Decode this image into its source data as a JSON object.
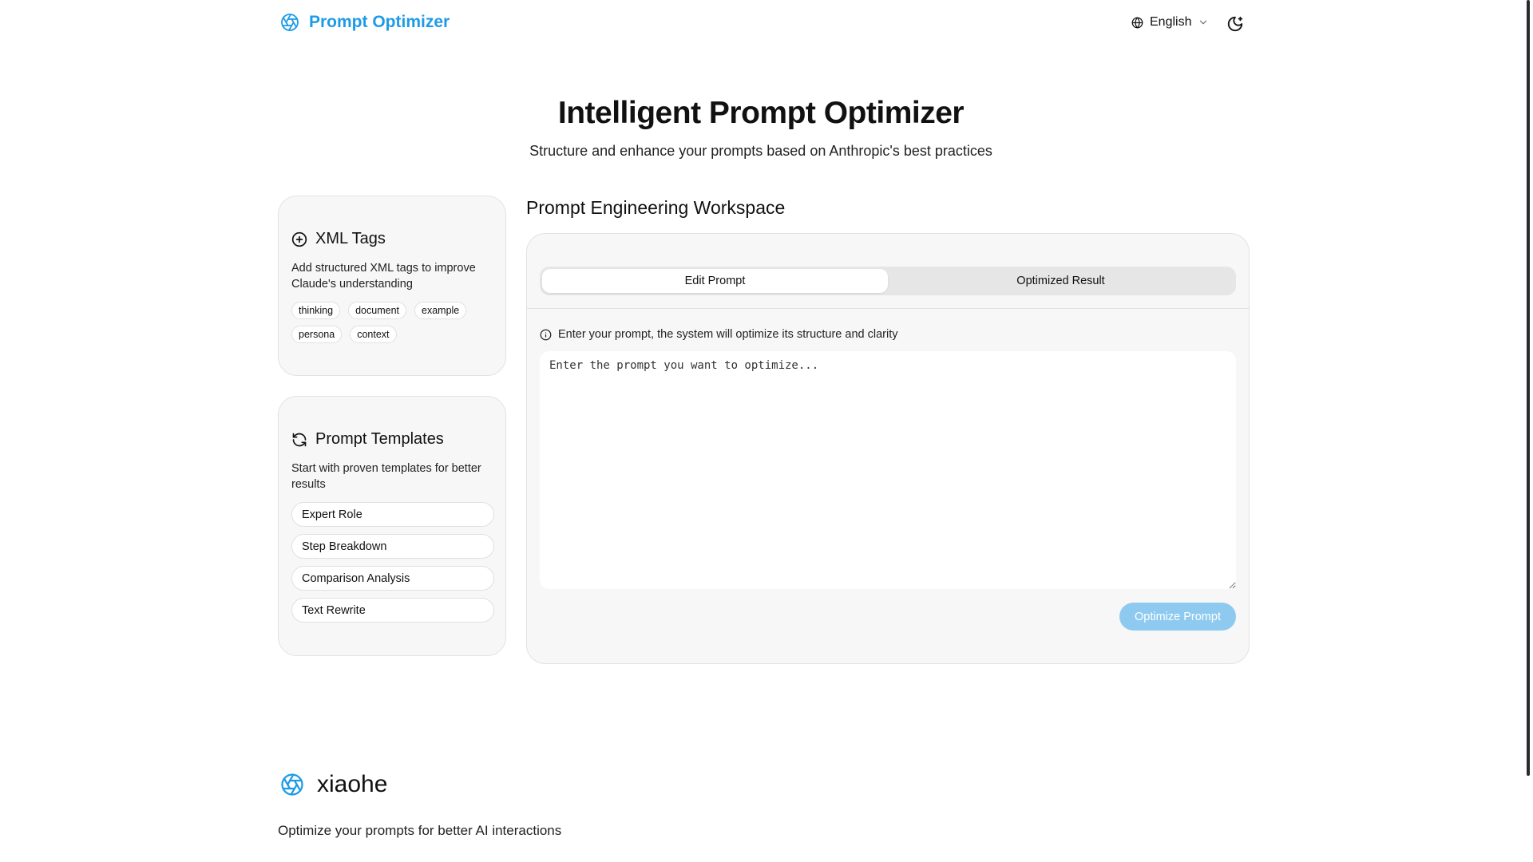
{
  "header": {
    "brand_name": "Prompt Optimizer",
    "brand_icon": "aperture-icon",
    "language_label": "English",
    "language_icon": "globe-icon",
    "theme_icon": "moon-icon"
  },
  "hero": {
    "title": "Intelligent Prompt Optimizer",
    "subtitle": "Structure and enhance your prompts based on Anthropic's best practices"
  },
  "xml_tags": {
    "icon": "plus-circle-icon",
    "title": "XML Tags",
    "description": "Add structured XML tags to improve Claude's understanding",
    "tags": [
      "thinking",
      "document",
      "example",
      "persona",
      "context"
    ]
  },
  "templates": {
    "icon": "refresh-icon",
    "title": "Prompt Templates",
    "description": "Start with proven templates for better results",
    "items": [
      "Expert Role",
      "Step Breakdown",
      "Comparison Analysis",
      "Text Rewrite"
    ]
  },
  "workspace": {
    "title": "Prompt Engineering Workspace",
    "tabs": [
      "Edit Prompt",
      "Optimized Result"
    ],
    "active_tab": "Edit Prompt",
    "hint_icon": "info-icon",
    "hint": "Enter your prompt, the system will optimize its structure and clarity",
    "placeholder": "Enter the prompt you want to optimize...",
    "value": "",
    "optimize_label": "Optimize Prompt"
  },
  "footer": {
    "brand_name": "xiaohe",
    "tagline": "Optimize your prompts for better AI interactions"
  },
  "colors": {
    "accent": "#1e9be6",
    "button_disabled": "#8ecaf0",
    "card_bg": "#f7f7f7"
  }
}
